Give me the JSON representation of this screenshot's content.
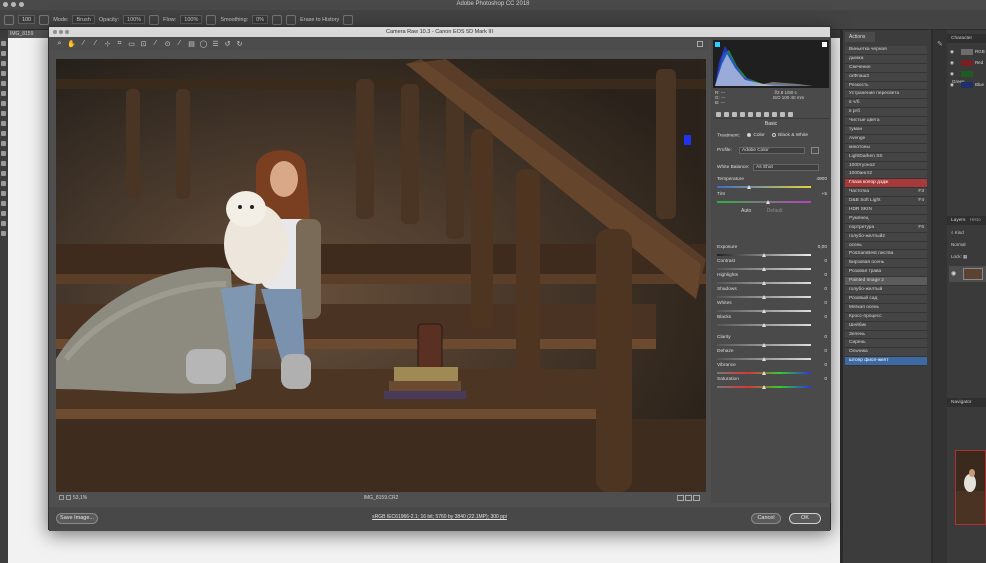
{
  "app": {
    "title": "Adobe Photoshop CC 2018"
  },
  "options_bar": {
    "mode_label": "Mode:",
    "mode_value": "Brush",
    "opacity_label": "Opacity:",
    "opacity_value": "100%",
    "flow_label": "Flow:",
    "flow_value": "100%",
    "smoothing_label": "Smoothing:",
    "smoothing_value": "0%",
    "erase_label": "Erase to History",
    "brush_size": "100"
  },
  "doc_tab": {
    "label": "IMG_8159"
  },
  "camera_raw": {
    "title": "Camera Raw 10.3  -  Canon EOS 5D Mark III",
    "toolbar_icons": [
      "zoom-icon",
      "hand-icon",
      "white-balance-icon",
      "color-sampler-icon",
      "targeted-adjust-icon",
      "crop-icon",
      "straighten-icon",
      "transform-icon",
      "spot-removal-icon",
      "red-eye-icon",
      "adjustment-brush-icon",
      "graduated-filter-icon",
      "radial-filter-icon",
      "preferences-icon",
      "rotate-left-icon",
      "rotate-right-icon"
    ],
    "zoom": "53,1%",
    "filename": "IMG_8159.CR2",
    "workflow": "sRGB IEC61966-2.1; 16 bit; 5760 by 3840 (22.1MP); 300 ppi",
    "save_label": "Save Image...",
    "cancel_label": "Cancel",
    "ok_label": "OK",
    "histogram": {
      "shadow_clip_color": "#2ad1ff",
      "highlight_clip_color": "#ffffff"
    },
    "readout": {
      "r_label": "R:",
      "r_value": "---",
      "g_label": "G:",
      "g_value": "---",
      "b_label": "B:",
      "b_value": "---",
      "exposure_info": "f/2.8   1/80 s",
      "iso_info": "ISO 100   40 mm"
    },
    "basic": {
      "header": "Basic",
      "treatment_label": "Treatment:",
      "treatment_color": "Color",
      "treatment_bw": "Black & White",
      "profile_label": "Profile:",
      "profile_value": "Adobe Color",
      "wb_label": "White Balance:",
      "wb_value": "As Shot",
      "temperature_label": "Temperature",
      "temperature_value": "4900",
      "tint_label": "Tint",
      "tint_value": "+5",
      "auto_label": "Auto",
      "default_label": "Default",
      "sliders": [
        {
          "label": "Exposure",
          "value": "0,00"
        },
        {
          "label": "Contrast",
          "value": "0"
        },
        {
          "label": "Highlights",
          "value": "0"
        },
        {
          "label": "Shadows",
          "value": "0"
        },
        {
          "label": "Whites",
          "value": "0"
        },
        {
          "label": "Blacks",
          "value": "0"
        },
        {
          "label": "Clarity",
          "value": "0"
        },
        {
          "label": "Dehaze",
          "value": "0"
        },
        {
          "label": "Vibrance",
          "value": "0"
        },
        {
          "label": "Saturation",
          "value": "0"
        }
      ]
    }
  },
  "actions_panel": {
    "tab_label": "Actions",
    "items": [
      {
        "label": "Виньетка черная",
        "key": ""
      },
      {
        "label": "дымка",
        "key": ""
      },
      {
        "label": "Свечение",
        "key": ""
      },
      {
        "label": "скФлаш3",
        "key": ""
      },
      {
        "label": "Резкость",
        "key": ""
      },
      {
        "label": "Устранение пересвета",
        "key": ""
      },
      {
        "label": "в ч/б",
        "key": ""
      },
      {
        "label": "в ргб",
        "key": ""
      },
      {
        "label": "Чистые цвета",
        "key": ""
      },
      {
        "label": "туман",
        "key": ""
      },
      {
        "label": "Avenge",
        "key": ""
      },
      {
        "label": "кинотоны",
        "key": ""
      },
      {
        "label": "LightDarken SS",
        "key": ""
      },
      {
        "label": "1000туоно2",
        "key": ""
      },
      {
        "label": "1000англ2",
        "key": ""
      },
      {
        "label": "Глаза колор дэдж",
        "key": ""
      },
      {
        "label": "Частотка",
        "key": "F3"
      },
      {
        "label": "D&B Soft Light",
        "key": "F4"
      },
      {
        "label": "HDR SKIN",
        "key": ""
      },
      {
        "label": "Румянец",
        "key": ""
      },
      {
        "label": "портретура",
        "key": "F6"
      },
      {
        "label": "голубо-желтый2",
        "key": ""
      },
      {
        "label": "осень",
        "key": ""
      },
      {
        "label": "PosSamBest листва",
        "key": ""
      },
      {
        "label": "Бирзовая осень",
        "key": ""
      },
      {
        "label": "Розовая трава",
        "key": ""
      },
      {
        "label": "Painted Image 2",
        "key": ""
      },
      {
        "label": "голубо-желтый",
        "key": ""
      },
      {
        "label": "Розовый сад",
        "key": ""
      },
      {
        "label": "Мягкая осень",
        "key": ""
      },
      {
        "label": "Кросс-процесс",
        "key": ""
      },
      {
        "label": "Шейбик",
        "key": ""
      },
      {
        "label": "Зелень",
        "key": ""
      },
      {
        "label": "Сирень",
        "key": ""
      },
      {
        "label": "Ольчика",
        "key": ""
      },
      {
        "label": "штопр фиол-желт",
        "key": ""
      }
    ],
    "highlight_red_index": 15,
    "highlight_gray_index": 26,
    "highlight_blue_index": 35
  },
  "channels_panel": {
    "tab_label": "Character",
    "rows": [
      {
        "label": "RGB",
        "swatch": "#6d6d6d"
      },
      {
        "label": "Red",
        "swatch": "#7a2020"
      },
      {
        "label": "Green",
        "swatch": "#1f5a1f"
      },
      {
        "label": "Blue",
        "swatch": "#1f2f6a"
      }
    ]
  },
  "layers_panel": {
    "tab_label": "Layers",
    "tab2_label": "Histo",
    "kind_label": "Kind",
    "mode_value": "Normal",
    "lock_label": "Lock:"
  },
  "navigator_panel": {
    "tab_label": "Navigator"
  }
}
